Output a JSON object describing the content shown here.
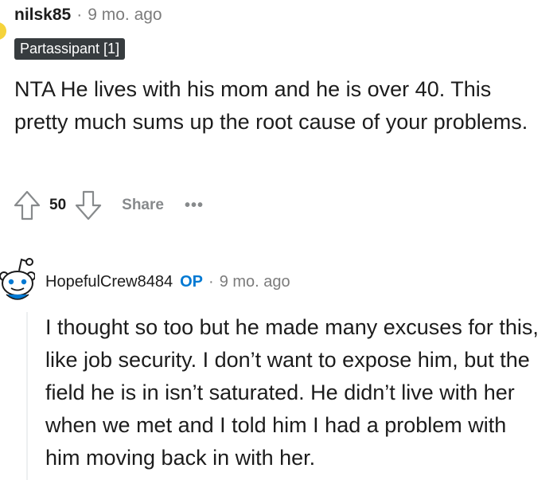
{
  "comment": {
    "username": "nilsk85",
    "separator": "·",
    "time": "9 mo. ago",
    "flair": "Partassipant [1]",
    "body": "NTA He lives with his mom and he is over 40. This pretty much sums up the root cause of your problems.",
    "actions": {
      "vote_count": "50",
      "share_label": "Share",
      "more_label": "•••"
    }
  },
  "reply": {
    "username": "HopefulCrew8484",
    "op_badge": "OP",
    "separator": "·",
    "time": "9 mo. ago",
    "body": "I thought so too but he made many excuses for this, like job security. I don’t want to expose him, but the field he is in isn’t saturated. He didn’t live with her when we met and I told him I had a problem with him moving back in with her."
  },
  "icons": {
    "upvote": "arrow-up-icon",
    "downvote": "arrow-down-icon",
    "avatar": "snoo-avatar-icon"
  },
  "colors": {
    "op_blue": "#0079d3",
    "flair_bg": "#373c3f",
    "meta_gray": "#7c7c7c",
    "action_gray": "#878a8c"
  }
}
